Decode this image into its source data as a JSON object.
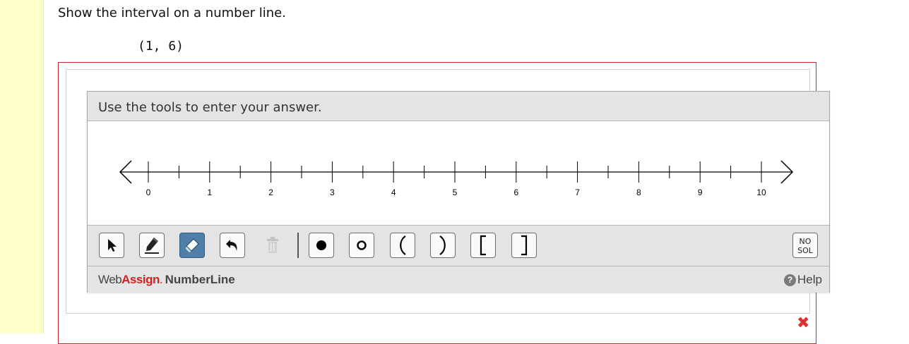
{
  "question": {
    "prompt": "Show the interval on a number line.",
    "interval": "(1, 6)"
  },
  "tool": {
    "header": "Use the tools to enter your answer.",
    "number_line": {
      "min": 0,
      "max": 10,
      "major_step": 1,
      "minor_step": 0.5,
      "labels": [
        "0",
        "1",
        "2",
        "3",
        "4",
        "5",
        "6",
        "7",
        "8",
        "9",
        "10"
      ]
    },
    "toolbar": {
      "select_label": "select-tool",
      "draw_label": "draw-tool",
      "eraser_label": "eraser-tool",
      "undo_label": "undo",
      "trash_label": "delete",
      "closed_point_label": "closed-point",
      "open_point_label": "open-point",
      "left_paren": "(",
      "right_paren": ")",
      "left_bracket": "[",
      "right_bracket": "]",
      "no_sol_line1": "NO",
      "no_sol_line2": "SOL",
      "active_tool": "eraser"
    },
    "footer": {
      "brand_web": "Web",
      "brand_assign": "Assign",
      "brand_dot": ".",
      "brand_product": "NumberLine",
      "help": "Help"
    }
  },
  "status": {
    "incorrect_mark": "✖"
  },
  "colors": {
    "left_bar": "#ffffcc",
    "frame_red": "#cc2a2a",
    "active_tool": "#4f7fa8",
    "brand_red": "#d32020"
  }
}
